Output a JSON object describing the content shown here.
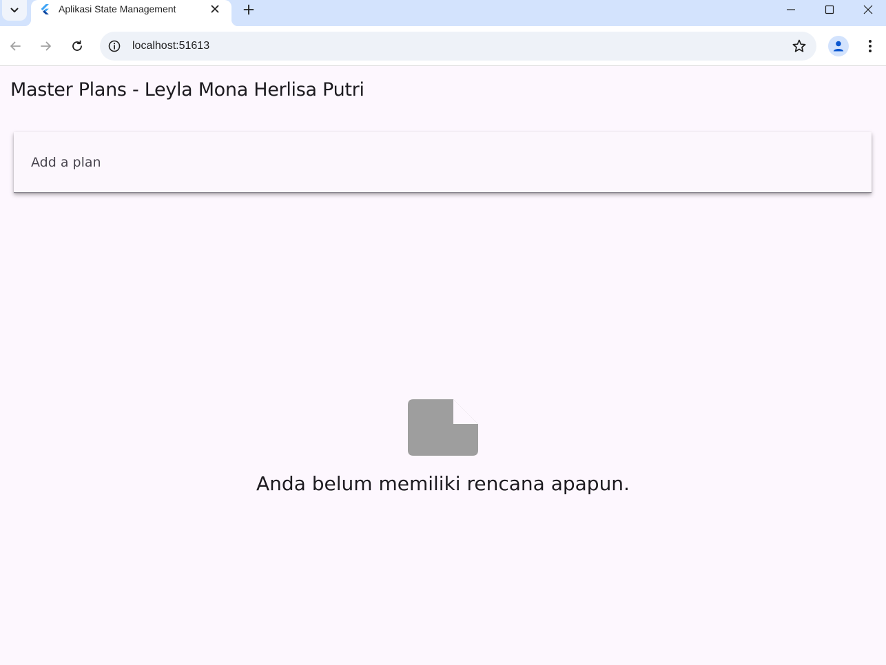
{
  "browser": {
    "tab_title": "Aplikasi State Management",
    "url": "localhost:51613"
  },
  "app": {
    "title": "Master Plans - Leyla Mona Herlisa Putri",
    "plan_input_placeholder": "Add a plan",
    "empty_message": "Anda belum memiliki rencana apapun."
  },
  "colors": {
    "background": "#fdf7fe",
    "tabstrip": "#d3e3fd",
    "empty_icon": "#9e9e9e",
    "profile_icon": "#0b57d0"
  },
  "icons": {
    "tab_search": "chevron-down-icon",
    "favicon": "flutter-icon",
    "tab_close": "close-icon",
    "new_tab": "plus-icon",
    "back": "arrow-left-icon",
    "forward": "arrow-right-icon",
    "reload": "reload-icon",
    "site_info": "info-icon",
    "bookmark": "star-icon",
    "profile": "person-icon",
    "menu": "kebab-menu-icon",
    "empty_state": "note-icon"
  }
}
